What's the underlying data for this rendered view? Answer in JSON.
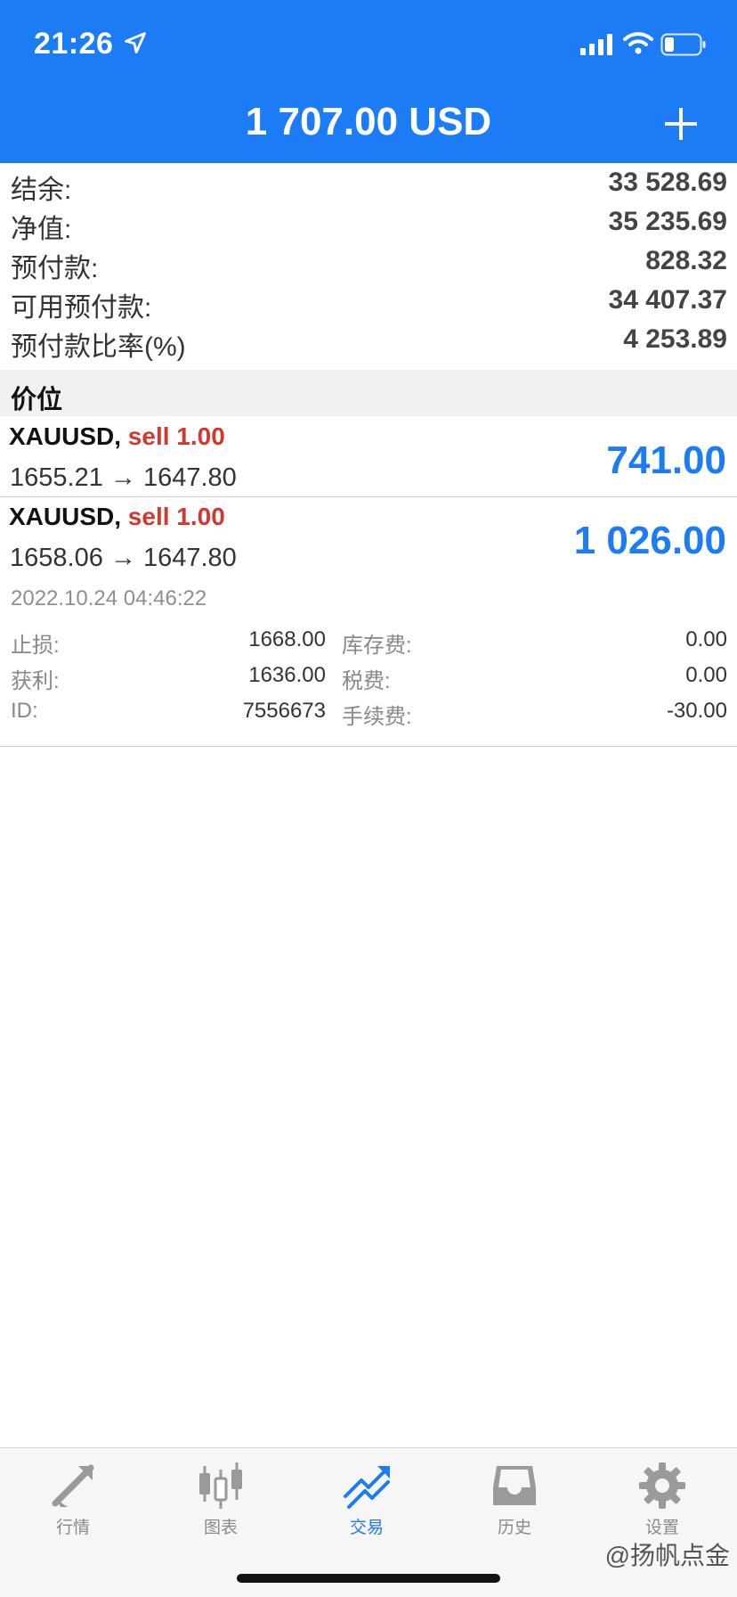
{
  "status_bar": {
    "time": "21:26"
  },
  "header": {
    "title": "1 707.00 USD"
  },
  "account": [
    {
      "label": "结余:",
      "value": "33 528.69"
    },
    {
      "label": "净值:",
      "value": "35 235.69"
    },
    {
      "label": "预付款:",
      "value": "828.32"
    },
    {
      "label": "可用预付款:",
      "value": "34 407.37"
    },
    {
      "label": "预付款比率(%)",
      "value": "4 253.89"
    }
  ],
  "section": {
    "title": "价位"
  },
  "positions": [
    {
      "symbol": "XAUUSD,",
      "side": "sell 1.00",
      "prices": "1655.21 → 1647.80",
      "profit": "741.00"
    },
    {
      "symbol": "XAUUSD,",
      "side": "sell 1.00",
      "prices": "1658.06 → 1647.80",
      "profit": "1 026.00",
      "time": "2022.10.24 04:46:22",
      "details": [
        {
          "label1": "止损:",
          "value1": "1668.00",
          "label2": "库存费:",
          "value2": "0.00"
        },
        {
          "label1": "获利:",
          "value1": "1636.00",
          "label2": "税费:",
          "value2": "0.00"
        },
        {
          "label1": "ID:",
          "value1": "7556673",
          "label2": "手续费:",
          "value2": "-30.00"
        }
      ]
    }
  ],
  "tabbar": {
    "tabs": [
      {
        "label": "行情",
        "icon": "quotes-arrows-icon"
      },
      {
        "label": "图表",
        "icon": "candlestick-icon"
      },
      {
        "label": "交易",
        "icon": "trade-trend-icon",
        "active": true
      },
      {
        "label": "历史",
        "icon": "inbox-history-icon"
      },
      {
        "label": "设置",
        "icon": "gear-icon"
      }
    ]
  },
  "watermark": "@扬帆点金",
  "colors": {
    "accent": "#1b7cf5",
    "sell": "#d1392e"
  }
}
